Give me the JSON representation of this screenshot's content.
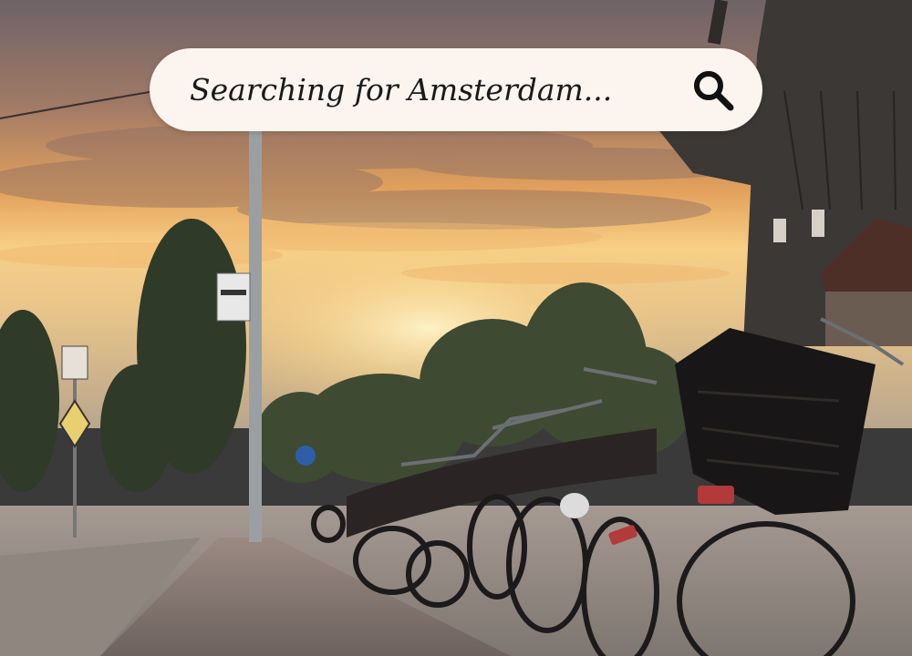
{
  "search": {
    "query": "Searching for Amsterdam...",
    "icon": "search-icon"
  },
  "scene": {
    "description_icon": "amsterdam-street-photo",
    "colors": {
      "sky_top": "#7a6a70",
      "sky_glow": "#f3b463",
      "pavement": "#8a7c78",
      "windmill": "#3b3835"
    }
  }
}
